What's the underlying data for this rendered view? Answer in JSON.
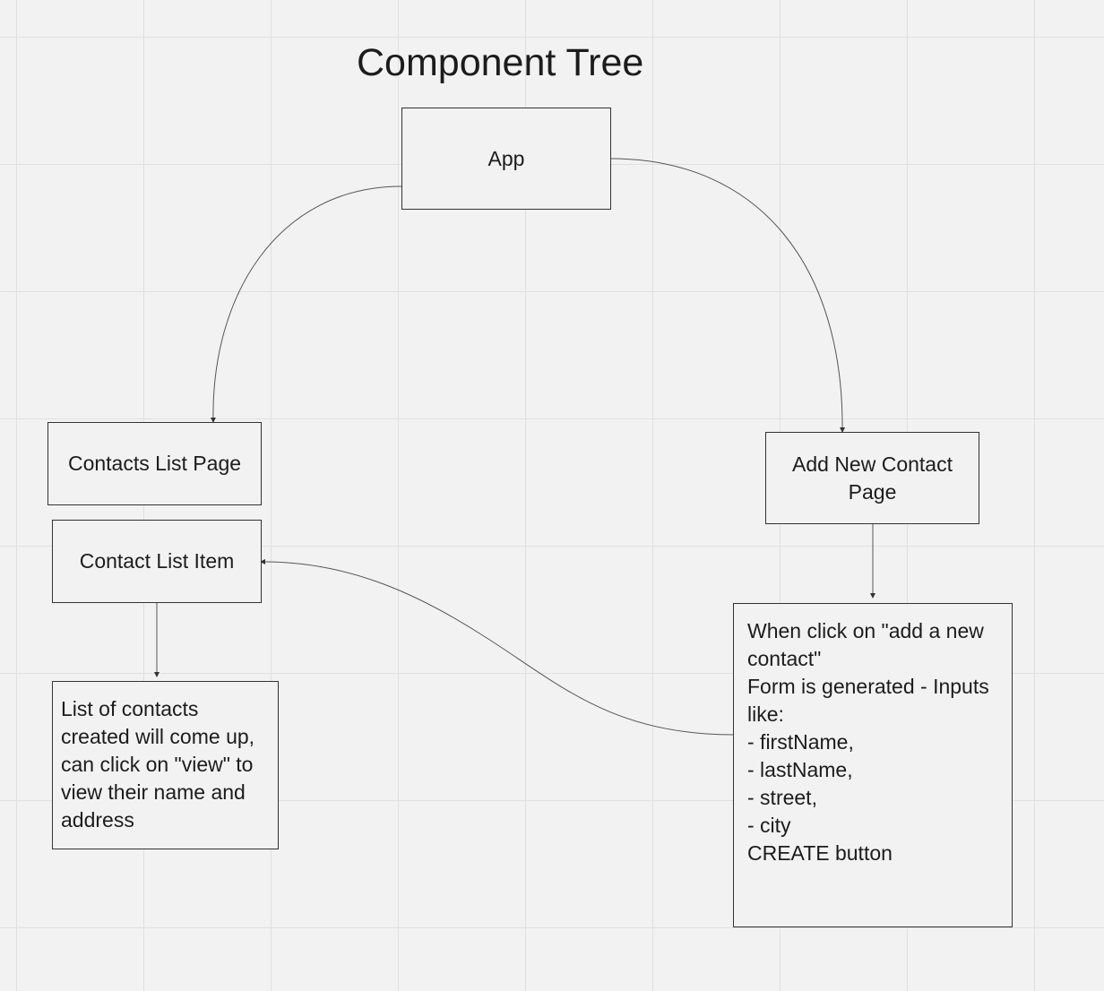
{
  "diagram": {
    "title": "Component Tree",
    "nodes": {
      "app": "App",
      "contacts_list_page": "Contacts List Page",
      "contact_list_item": "Contact List Item",
      "contacts_list_note": "List of contacts created will come up, can click on \"view\" to view their name and address",
      "add_new_contact_page": "Add New Contact Page",
      "form_note": {
        "lines": [
          "When click on \"add a new contact\"",
          "Form is generated - Inputs like:",
          "- firstName,",
          "- lastName,",
          "- street,",
          "- city",
          "CREATE button"
        ]
      }
    },
    "edges": [
      {
        "from": "app",
        "to": "contacts_list_page"
      },
      {
        "from": "app",
        "to": "add_new_contact_page"
      },
      {
        "from": "contact_list_item",
        "to": "contacts_list_note"
      },
      {
        "from": "add_new_contact_page",
        "to": "form_note"
      },
      {
        "from": "form_note",
        "to": "contact_list_item"
      }
    ]
  }
}
